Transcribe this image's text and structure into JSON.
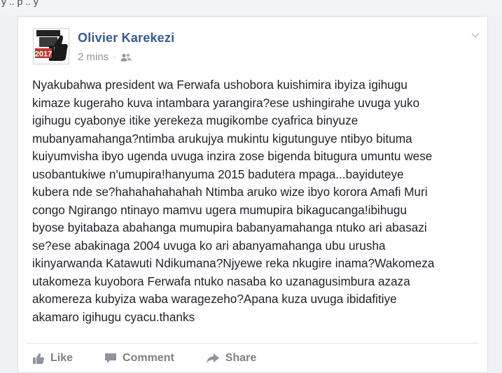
{
  "top_strip": {
    "text": "y  ..   p  ..  y"
  },
  "post": {
    "author": "Olivier Karekezi",
    "timestamp": "2 mins",
    "separator": "·",
    "audience_icon": "friends-icon",
    "avatar": {
      "year_text": "2017",
      "icon": "thumbs-up-icon"
    },
    "body": "Nyakubahwa president wa Ferwafa ushobora kuishimira ibyiza igihugu\nkimaze kugeraho kuva intambara yarangira?ese ushingirahe uvuga yuko\nigihugu cyabonye itike yerekeza mugikombe cyafrica binyuze\nmubanyamahanga?ntimba arukujya mukintu kigutunguye ntibyo bituma\nkuiyumvisha ibyo ugenda uvuga inzira zose bigenda bitugura umuntu wese\nusobantukiwe n'umupira!hanyuma 2015 badutera mpaga...bayiduteye\nkubera nde se?hahahahahahah Ntimba aruko wize ibyo korora Amafi Muri\ncongo Ngirango ntinayo mamvu ugera mumupira bikagucanga!ibihugu\nbyose byitabaza abahanga mumupira babanyamahanga ntuko ari abasazi\nse?ese abakinaga 2004 uvuga ko ari abanyamahanga ubu urusha\nikinyarwanda Katawuti Ndikumana?Njyewe reka nkugire inama?Wakomeza\nutakomeza kuyobora Ferwafa ntuko nasaba ko uzanagusimbura azaza\nakomereza kubyiza waba waragezeho?Apana kuza uvuga ibidafitiye\nakamaro igihugu cyacu.thanks"
  },
  "actions": [
    {
      "label": "Like",
      "icon": "like-icon"
    },
    {
      "label": "Comment",
      "icon": "comment-icon"
    },
    {
      "label": "Share",
      "icon": "share-icon"
    }
  ],
  "colors": {
    "author_link": "#365899",
    "meta_gray": "#90949c",
    "body_text": "#1d2129",
    "action_gray": "#7f7f7f"
  }
}
